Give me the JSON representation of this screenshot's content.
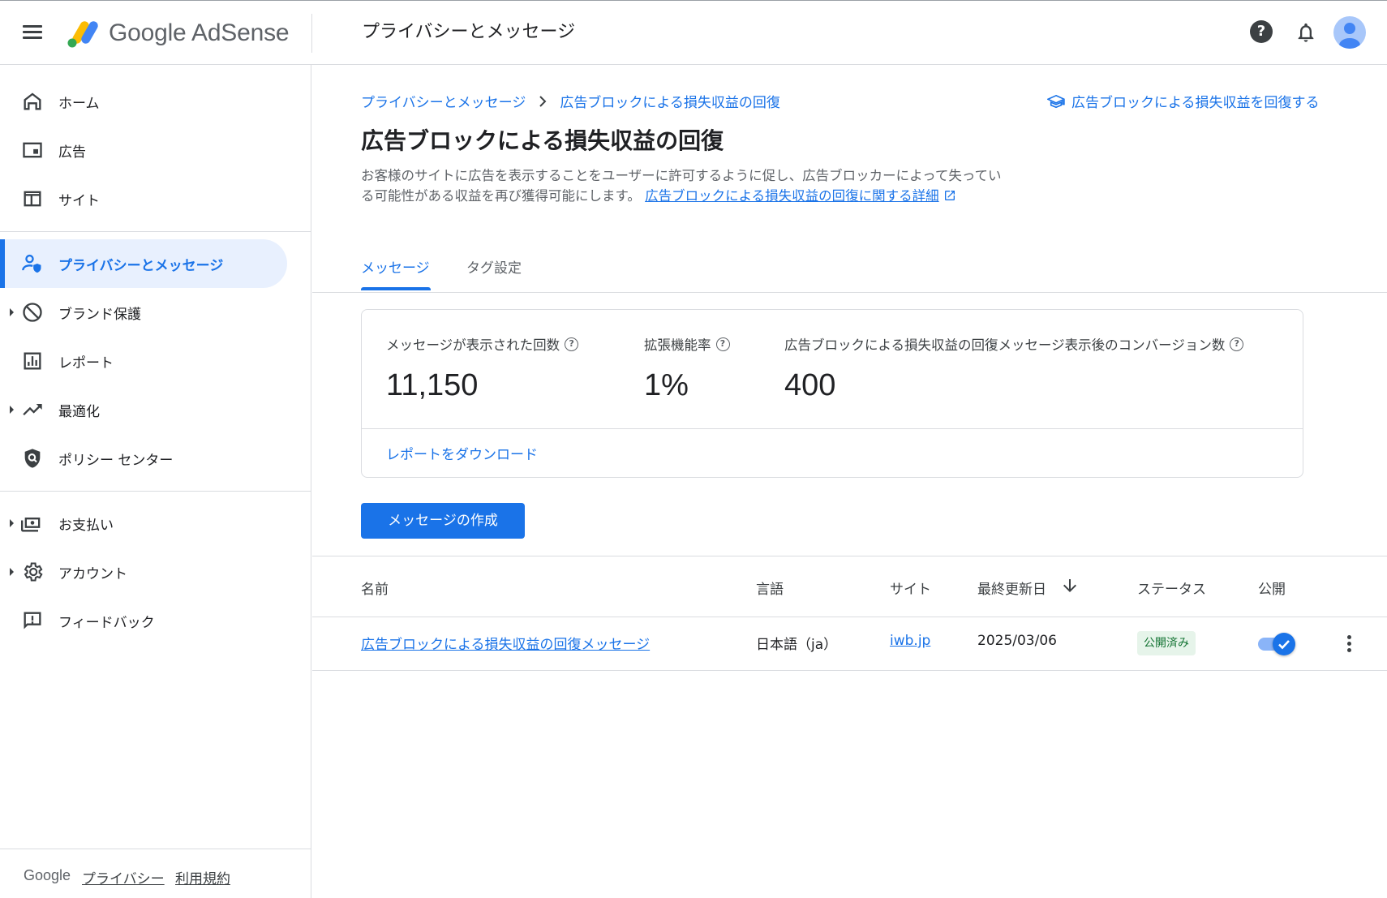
{
  "header": {
    "logo_text": "Google AdSense",
    "title": "プライバシーとメッセージ"
  },
  "sidebar": {
    "items": [
      {
        "label": "ホーム",
        "icon": "home-icon"
      },
      {
        "label": "広告",
        "icon": "ads-icon"
      },
      {
        "label": "サイト",
        "icon": "sites-icon"
      },
      {
        "label": "プライバシーとメッセージ",
        "icon": "privacy-icon",
        "active": true
      },
      {
        "label": "ブランド保護",
        "icon": "block-icon"
      },
      {
        "label": "レポート",
        "icon": "reports-icon"
      },
      {
        "label": "最適化",
        "icon": "trending-icon"
      },
      {
        "label": "ポリシー センター",
        "icon": "policy-icon"
      },
      {
        "label": "お支払い",
        "icon": "payments-icon"
      },
      {
        "label": "アカウント",
        "icon": "gear-icon"
      },
      {
        "label": "フィードバック",
        "icon": "feedback-icon"
      }
    ],
    "footer": {
      "brand": "Google",
      "privacy": "プライバシー",
      "terms": "利用規約"
    }
  },
  "breadcrumb": {
    "parent": "プライバシーとメッセージ",
    "current": "広告ブロックによる損失収益の回復"
  },
  "learn_link": "広告ブロックによる損失収益を回復する",
  "page": {
    "title": "広告ブロックによる損失収益の回復",
    "description": "お客様のサイトに広告を表示することをユーザーに許可するように促し、広告ブロッカーによって失っている可能性がある収益を再び獲得可能にします。",
    "more_link": "広告ブロックによる損失収益の回復に関する詳細"
  },
  "tabs": [
    {
      "label": "メッセージ",
      "active": true
    },
    {
      "label": "タグ設定",
      "active": false
    }
  ],
  "stats": [
    {
      "label": "メッセージが表示された回数",
      "value": "11,150"
    },
    {
      "label": "拡張機能率",
      "value": "1%"
    },
    {
      "label": "広告ブロックによる損失収益の回復メッセージ表示後のコンバージョン数",
      "value": "400"
    }
  ],
  "download_report": "レポートをダウンロード",
  "create_button": "メッセージの作成",
  "table": {
    "columns": [
      "名前",
      "言語",
      "サイト",
      "最終更新日",
      "ステータス",
      "公開"
    ],
    "rows": [
      {
        "name": "広告ブロックによる損失収益の回復メッセージ",
        "language": "日本語（ja）",
        "site": "iwb.jp",
        "updated": "2025/03/06",
        "status": "公開済み",
        "published": true
      }
    ]
  },
  "colors": {
    "accent": "#1a73e8",
    "active_bg": "#e8f0fe",
    "badge_bg": "#e6f4ea",
    "badge_text": "#137333"
  }
}
